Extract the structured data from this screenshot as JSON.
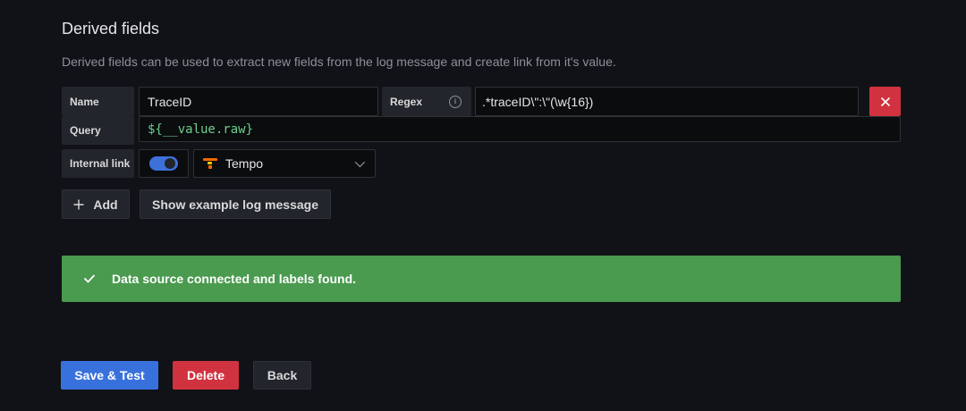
{
  "section": {
    "title": "Derived fields",
    "description": "Derived fields can be used to extract new fields from the log message and create link from it's value."
  },
  "field": {
    "name_label": "Name",
    "name_value": "TraceID",
    "regex_label": "Regex",
    "regex_value": ".*traceID\\\":\\\"(\\w{16})",
    "query_label": "Query",
    "query_value": "${__value.raw}",
    "internal_link_label": "Internal link",
    "internal_link_enabled": true,
    "datasource": "Tempo",
    "remove_icon": "close-icon",
    "info_icon": "info-icon"
  },
  "actions": {
    "add_label": "Add",
    "show_example_label": "Show example log message"
  },
  "alert": {
    "message": "Data source connected and labels found.",
    "color": "#4a9a4f"
  },
  "footer": {
    "save_test_label": "Save & Test",
    "delete_label": "Delete",
    "back_label": "Back"
  },
  "colors": {
    "background": "#111217",
    "primary": "#3871dc",
    "danger": "#d1323f",
    "success": "#4a9a4f",
    "tempo_brand": "#f46800"
  }
}
